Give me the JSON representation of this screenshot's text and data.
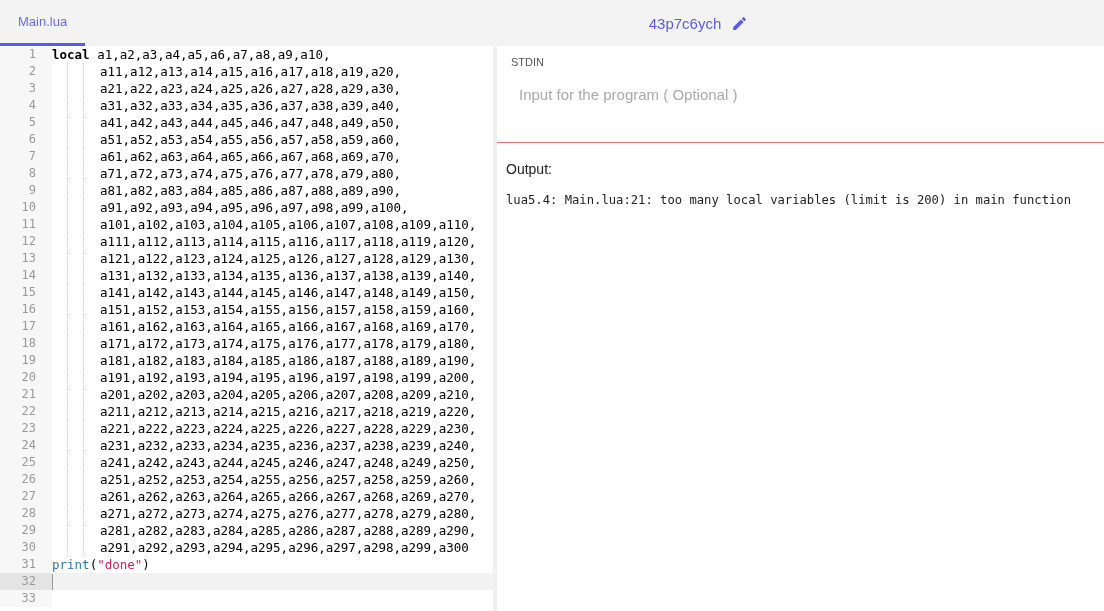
{
  "tabs": [
    {
      "label": "Main.lua",
      "selected": true
    }
  ],
  "project": {
    "title": "43p7c6ych"
  },
  "editor": {
    "lines": [
      {
        "number": "1",
        "indented": false,
        "current": false,
        "tokens": [
          {
            "kind": "keyword",
            "text": "local"
          },
          {
            "kind": "plain",
            "text": " a1,a2,a3,a4,a5,a6,a7,a8,a9,a10,"
          }
        ]
      },
      {
        "number": "2",
        "indented": true,
        "current": false,
        "tokens": [
          {
            "kind": "plain",
            "text": "a11,a12,a13,a14,a15,a16,a17,a18,a19,a20,"
          }
        ]
      },
      {
        "number": "3",
        "indented": true,
        "current": false,
        "tokens": [
          {
            "kind": "plain",
            "text": "a21,a22,a23,a24,a25,a26,a27,a28,a29,a30,"
          }
        ]
      },
      {
        "number": "4",
        "indented": true,
        "current": false,
        "tokens": [
          {
            "kind": "plain",
            "text": "a31,a32,a33,a34,a35,a36,a37,a38,a39,a40,"
          }
        ]
      },
      {
        "number": "5",
        "indented": true,
        "current": false,
        "tokens": [
          {
            "kind": "plain",
            "text": "a41,a42,a43,a44,a45,a46,a47,a48,a49,a50,"
          }
        ]
      },
      {
        "number": "6",
        "indented": true,
        "current": false,
        "tokens": [
          {
            "kind": "plain",
            "text": "a51,a52,a53,a54,a55,a56,a57,a58,a59,a60,"
          }
        ]
      },
      {
        "number": "7",
        "indented": true,
        "current": false,
        "tokens": [
          {
            "kind": "plain",
            "text": "a61,a62,a63,a64,a65,a66,a67,a68,a69,a70,"
          }
        ]
      },
      {
        "number": "8",
        "indented": true,
        "current": false,
        "tokens": [
          {
            "kind": "plain",
            "text": "a71,a72,a73,a74,a75,a76,a77,a78,a79,a80,"
          }
        ]
      },
      {
        "number": "9",
        "indented": true,
        "current": false,
        "tokens": [
          {
            "kind": "plain",
            "text": "a81,a82,a83,a84,a85,a86,a87,a88,a89,a90,"
          }
        ]
      },
      {
        "number": "10",
        "indented": true,
        "current": false,
        "tokens": [
          {
            "kind": "plain",
            "text": "a91,a92,a93,a94,a95,a96,a97,a98,a99,a100,"
          }
        ]
      },
      {
        "number": "11",
        "indented": true,
        "current": false,
        "tokens": [
          {
            "kind": "plain",
            "text": "a101,a102,a103,a104,a105,a106,a107,a108,a109,a110,"
          }
        ]
      },
      {
        "number": "12",
        "indented": true,
        "current": false,
        "tokens": [
          {
            "kind": "plain",
            "text": "a111,a112,a113,a114,a115,a116,a117,a118,a119,a120,"
          }
        ]
      },
      {
        "number": "13",
        "indented": true,
        "current": false,
        "tokens": [
          {
            "kind": "plain",
            "text": "a121,a122,a123,a124,a125,a126,a127,a128,a129,a130,"
          }
        ]
      },
      {
        "number": "14",
        "indented": true,
        "current": false,
        "tokens": [
          {
            "kind": "plain",
            "text": "a131,a132,a133,a134,a135,a136,a137,a138,a139,a140,"
          }
        ]
      },
      {
        "number": "15",
        "indented": true,
        "current": false,
        "tokens": [
          {
            "kind": "plain",
            "text": "a141,a142,a143,a144,a145,a146,a147,a148,a149,a150,"
          }
        ]
      },
      {
        "number": "16",
        "indented": true,
        "current": false,
        "tokens": [
          {
            "kind": "plain",
            "text": "a151,a152,a153,a154,a155,a156,a157,a158,a159,a160,"
          }
        ]
      },
      {
        "number": "17",
        "indented": true,
        "current": false,
        "tokens": [
          {
            "kind": "plain",
            "text": "a161,a162,a163,a164,a165,a166,a167,a168,a169,a170,"
          }
        ]
      },
      {
        "number": "18",
        "indented": true,
        "current": false,
        "tokens": [
          {
            "kind": "plain",
            "text": "a171,a172,a173,a174,a175,a176,a177,a178,a179,a180,"
          }
        ]
      },
      {
        "number": "19",
        "indented": true,
        "current": false,
        "tokens": [
          {
            "kind": "plain",
            "text": "a181,a182,a183,a184,a185,a186,a187,a188,a189,a190,"
          }
        ]
      },
      {
        "number": "20",
        "indented": true,
        "current": false,
        "tokens": [
          {
            "kind": "plain",
            "text": "a191,a192,a193,a194,a195,a196,a197,a198,a199,a200,"
          }
        ]
      },
      {
        "number": "21",
        "indented": true,
        "current": false,
        "tokens": [
          {
            "kind": "plain",
            "text": "a201,a202,a203,a204,a205,a206,a207,a208,a209,a210,"
          }
        ]
      },
      {
        "number": "22",
        "indented": true,
        "current": false,
        "tokens": [
          {
            "kind": "plain",
            "text": "a211,a212,a213,a214,a215,a216,a217,a218,a219,a220,"
          }
        ]
      },
      {
        "number": "23",
        "indented": true,
        "current": false,
        "tokens": [
          {
            "kind": "plain",
            "text": "a221,a222,a223,a224,a225,a226,a227,a228,a229,a230,"
          }
        ]
      },
      {
        "number": "24",
        "indented": true,
        "current": false,
        "tokens": [
          {
            "kind": "plain",
            "text": "a231,a232,a233,a234,a235,a236,a237,a238,a239,a240,"
          }
        ]
      },
      {
        "number": "25",
        "indented": true,
        "current": false,
        "tokens": [
          {
            "kind": "plain",
            "text": "a241,a242,a243,a244,a245,a246,a247,a248,a249,a250,"
          }
        ]
      },
      {
        "number": "26",
        "indented": true,
        "current": false,
        "tokens": [
          {
            "kind": "plain",
            "text": "a251,a252,a253,a254,a255,a256,a257,a258,a259,a260,"
          }
        ]
      },
      {
        "number": "27",
        "indented": true,
        "current": false,
        "tokens": [
          {
            "kind": "plain",
            "text": "a261,a262,a263,a264,a265,a266,a267,a268,a269,a270,"
          }
        ]
      },
      {
        "number": "28",
        "indented": true,
        "current": false,
        "tokens": [
          {
            "kind": "plain",
            "text": "a271,a272,a273,a274,a275,a276,a277,a278,a279,a280,"
          }
        ]
      },
      {
        "number": "29",
        "indented": true,
        "current": false,
        "tokens": [
          {
            "kind": "plain",
            "text": "a281,a282,a283,a284,a285,a286,a287,a288,a289,a290,"
          }
        ]
      },
      {
        "number": "30",
        "indented": true,
        "current": false,
        "tokens": [
          {
            "kind": "plain",
            "text": "a291,a292,a293,a294,a295,a296,a297,a298,a299,a300"
          }
        ]
      },
      {
        "number": "31",
        "indented": false,
        "current": false,
        "tokens": [
          {
            "kind": "function",
            "text": "print"
          },
          {
            "kind": "plain",
            "text": "("
          },
          {
            "kind": "string",
            "text": "\"done\""
          },
          {
            "kind": "plain",
            "text": ")"
          }
        ]
      },
      {
        "number": "32",
        "indented": false,
        "current": true
      },
      {
        "number": "33",
        "indented": false,
        "current": false
      }
    ]
  },
  "stdin": {
    "label": "STDIN",
    "placeholder": "Input for the program ( Optional )"
  },
  "output": {
    "label": "Output:",
    "text": "lua5.4: Main.lua:21: too many local variables (limit is 200) in main function"
  }
}
